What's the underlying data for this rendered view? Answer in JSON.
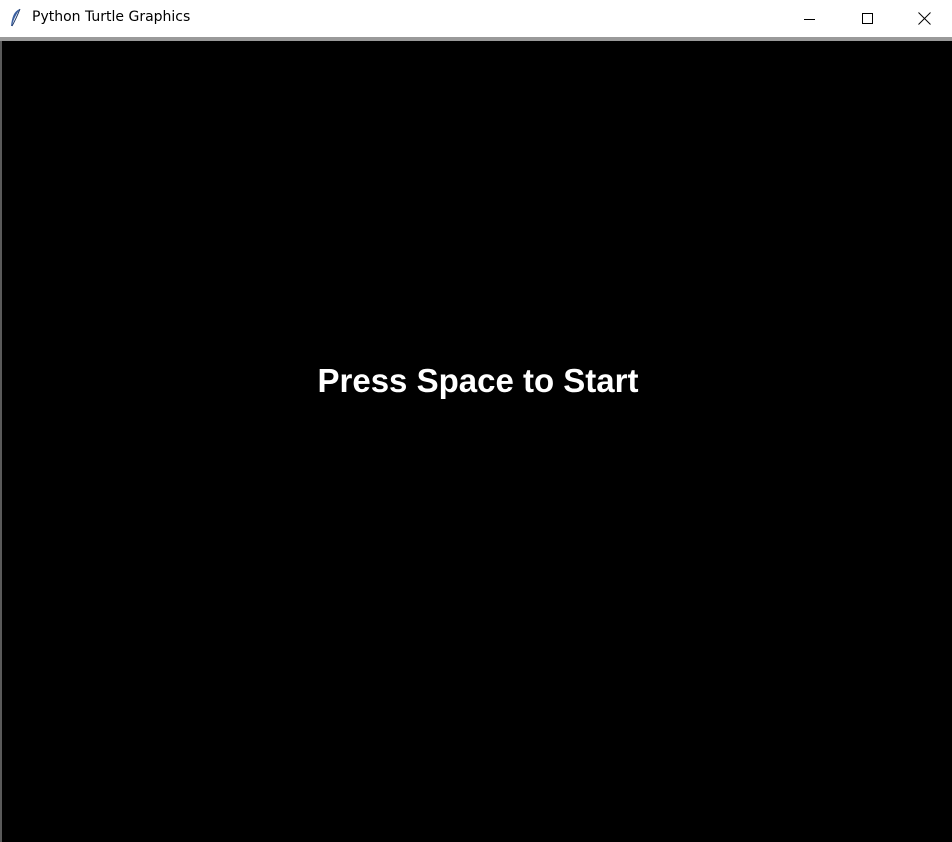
{
  "window": {
    "title": "Python Turtle Graphics"
  },
  "titlebar_icons": {
    "app_icon": "feather-icon",
    "minimize_icon": "minimize-icon",
    "maximize_icon": "maximize-icon",
    "close_icon": "close-icon"
  },
  "canvas": {
    "background_color": "#000000",
    "text_color": "#ffffff",
    "message": "Press Space to Start"
  }
}
